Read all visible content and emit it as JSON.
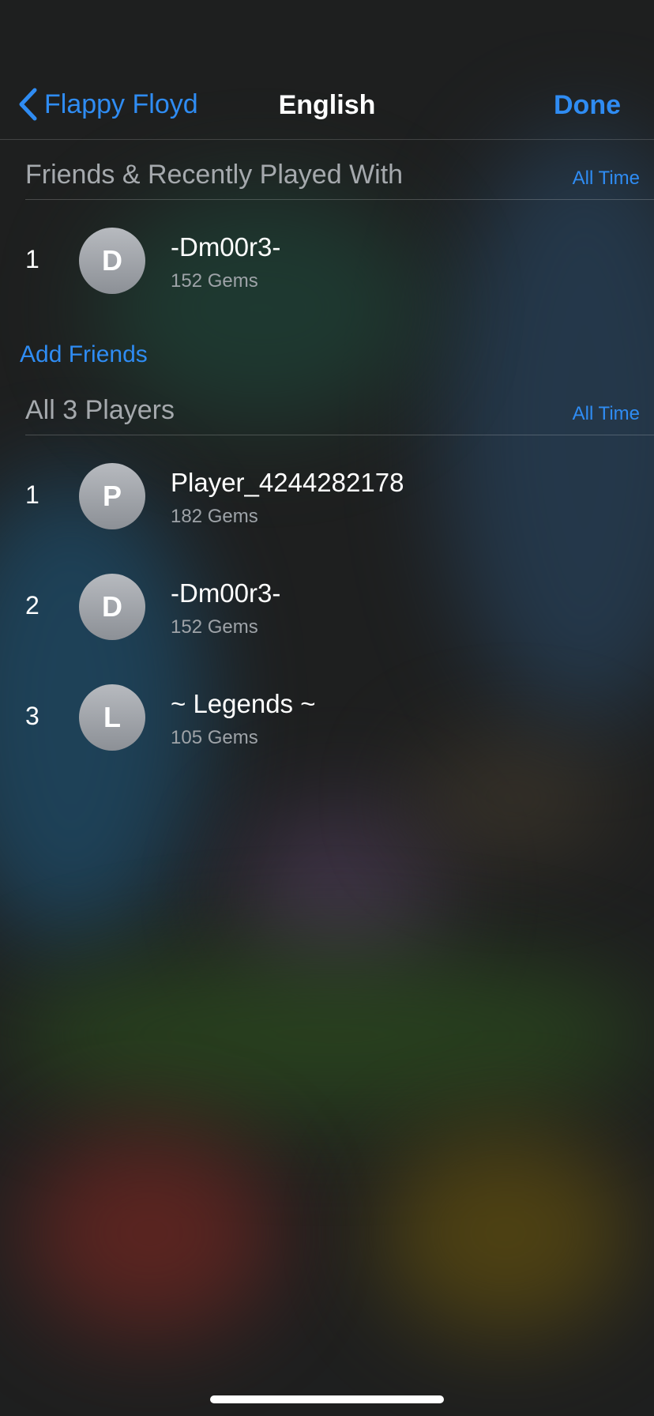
{
  "nav": {
    "back_label": "Flappy Floyd",
    "title": "English",
    "done_label": "Done"
  },
  "friends_section": {
    "title": "Friends & Recently Played With",
    "filter": "All Time",
    "players": [
      {
        "rank": "1",
        "initial": "D",
        "name": "-Dm00r3-",
        "score": "152 Gems"
      }
    ]
  },
  "add_friends_label": "Add Friends",
  "all_section": {
    "title": "All 3 Players",
    "filter": "All Time",
    "players": [
      {
        "rank": "1",
        "initial": "P",
        "name": "Player_4244282178",
        "score": "182 Gems"
      },
      {
        "rank": "2",
        "initial": "D",
        "name": "-Dm00r3-",
        "score": "152 Gems"
      },
      {
        "rank": "3",
        "initial": "L",
        "name": "~ Legends ~",
        "score": "105 Gems"
      }
    ]
  },
  "colors": {
    "accent": "#2f8cf3",
    "background": "#1e1f1f",
    "secondary_text": "#9ea3a8"
  },
  "icons": {
    "back": "chevron-left-icon"
  }
}
